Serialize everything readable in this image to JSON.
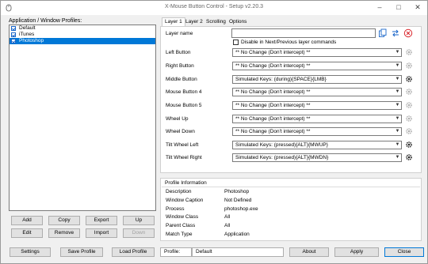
{
  "window": {
    "title": "X-Mouse Button Control - Setup v2.20.3"
  },
  "titlebar": {
    "minimize_glyph": "–",
    "maximize_glyph": "□",
    "close_glyph": "✕"
  },
  "profiles": {
    "label": "Application / Window Profiles:",
    "items": [
      {
        "label": "Default",
        "checked": true,
        "selected": false
      },
      {
        "label": "iTunes",
        "checked": true,
        "selected": false
      },
      {
        "label": "Photoshop",
        "checked": true,
        "selected": true
      }
    ],
    "buttons": {
      "add": "Add",
      "copy": "Copy",
      "export": "Export",
      "up": "Up",
      "edit": "Edit",
      "remove": "Remove",
      "import": "Import",
      "down": "Down"
    }
  },
  "tabs": [
    {
      "label": "Layer 1",
      "active": true
    },
    {
      "label": "Layer 2",
      "active": false
    },
    {
      "label": "Scrolling",
      "active": false
    },
    {
      "label": "Options",
      "active": false
    }
  ],
  "layer": {
    "name_label": "Layer name",
    "name_value": "",
    "disable_label": "Disable in Next/Previous layer commands",
    "disable_checked": false
  },
  "mappings": [
    {
      "label": "Left Button",
      "value": "** No Change (Don't intercept) **",
      "configurable": false
    },
    {
      "label": "Right Button",
      "value": "** No Change (Don't intercept) **",
      "configurable": false
    },
    {
      "label": "Middle Button",
      "value": "Simulated Keys: (during){SPACE}{LMB}",
      "configurable": true
    },
    {
      "label": "Mouse Button 4",
      "value": "** No Change (Don't intercept) **",
      "configurable": false
    },
    {
      "label": "Mouse Button 5",
      "value": "** No Change (Don't intercept) **",
      "configurable": false
    },
    {
      "label": "Wheel Up",
      "value": "** No Change (Don't intercept) **",
      "configurable": false
    },
    {
      "label": "Wheel Down",
      "value": "** No Change (Don't intercept) **",
      "configurable": false
    },
    {
      "label": "Tilt Wheel Left",
      "value": "Simulated Keys: (pressed){ALT}{MWUP}",
      "configurable": true
    },
    {
      "label": "Tilt Wheel Right",
      "value": "Simulated Keys: (pressed){ALT}{MWDN}",
      "configurable": true
    }
  ],
  "profile_info": {
    "title": "Profile Information",
    "rows": [
      {
        "key": "Description",
        "value": "Photoshop"
      },
      {
        "key": "Window Caption",
        "value": "Not Defined"
      },
      {
        "key": "Process",
        "value": "photoshop.exe"
      },
      {
        "key": "Window Class",
        "value": "All"
      },
      {
        "key": "Parent Class",
        "value": "All"
      },
      {
        "key": "Match Type",
        "value": "Application"
      }
    ]
  },
  "footer": {
    "settings": "Settings",
    "save_profile": "Save Profile",
    "load_profile": "Load Profile",
    "profile_label": "Profile:",
    "profile_value": "Default",
    "about": "About",
    "apply": "Apply",
    "close": "Close"
  },
  "colors": {
    "accent": "#0078d7",
    "close_red": "#d9262c",
    "gear": "#8c8c8c"
  }
}
